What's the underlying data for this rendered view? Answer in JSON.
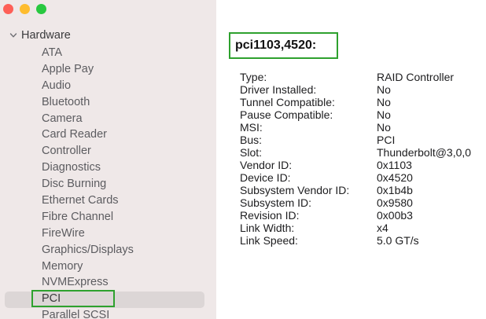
{
  "window": {
    "controls": [
      "close",
      "minimize",
      "zoom"
    ]
  },
  "sidebar": {
    "group": {
      "label": "Hardware",
      "expanded": true,
      "icon": "chevron-down-icon"
    },
    "selected": "PCI",
    "items": [
      {
        "label": "ATA"
      },
      {
        "label": "Apple Pay"
      },
      {
        "label": "Audio"
      },
      {
        "label": "Bluetooth"
      },
      {
        "label": "Camera"
      },
      {
        "label": "Card Reader"
      },
      {
        "label": "Controller"
      },
      {
        "label": "Diagnostics"
      },
      {
        "label": "Disc Burning"
      },
      {
        "label": "Ethernet Cards"
      },
      {
        "label": "Fibre Channel"
      },
      {
        "label": "FireWire"
      },
      {
        "label": "Graphics/Displays"
      },
      {
        "label": "Memory"
      },
      {
        "label": "NVMExpress"
      },
      {
        "label": "PCI"
      },
      {
        "label": "Parallel SCSI"
      }
    ]
  },
  "detail": {
    "title": "pci1103,4520:",
    "properties": [
      {
        "key": "Type:",
        "value": "RAID Controller"
      },
      {
        "key": "Driver Installed:",
        "value": "No"
      },
      {
        "key": "Tunnel Compatible:",
        "value": "No"
      },
      {
        "key": "Pause Compatible:",
        "value": "No"
      },
      {
        "key": "MSI:",
        "value": "No"
      },
      {
        "key": "Bus:",
        "value": "PCI"
      },
      {
        "key": "Slot:",
        "value": "Thunderbolt@3,0,0"
      },
      {
        "key": "Vendor ID:",
        "value": "0x1103"
      },
      {
        "key": "Device ID:",
        "value": "0x4520"
      },
      {
        "key": "Subsystem Vendor ID:",
        "value": "0x1b4b"
      },
      {
        "key": "Subsystem ID:",
        "value": "0x9580"
      },
      {
        "key": "Revision ID:",
        "value": "0x00b3"
      },
      {
        "key": "Link Width:",
        "value": "x4"
      },
      {
        "key": "Link Speed:",
        "value": "5.0 GT/s"
      }
    ]
  },
  "colors": {
    "sidebar_bg": "#efe8e8",
    "selection_bg": "#dcd6d6",
    "highlight_box": "#2ea12e",
    "close": "#fe5f57",
    "minimize": "#febc2e",
    "zoom": "#28c840"
  }
}
